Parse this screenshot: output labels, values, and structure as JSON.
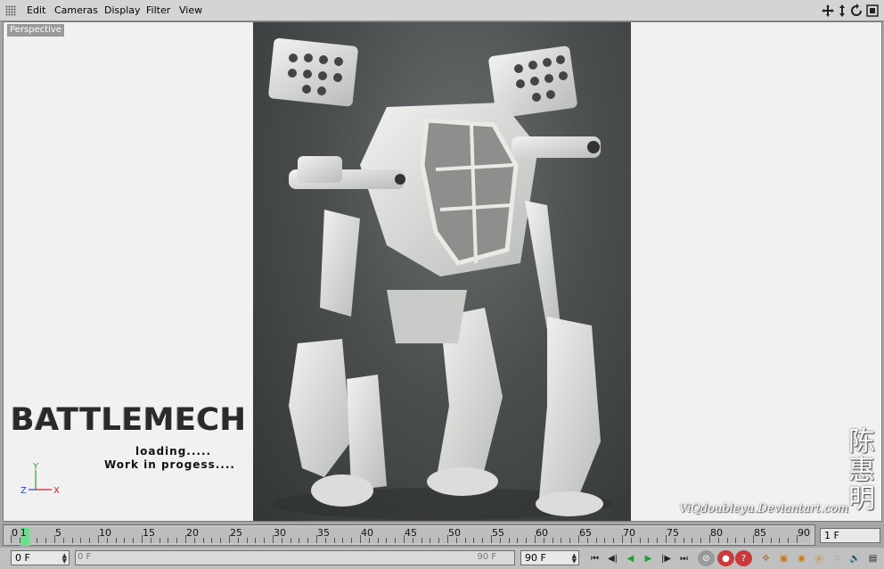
{
  "menu": {
    "items": [
      "Edit",
      "Cameras",
      "Display",
      "Filter",
      "View"
    ]
  },
  "nav_icons": [
    "move-icon",
    "zoom-icon",
    "rotate-icon",
    "maximize-icon"
  ],
  "viewport": {
    "camera_label": "Perspective",
    "overlay": {
      "title": "BATTLEMECH",
      "loading": "loading.....",
      "wip": "Work in progess....",
      "signature": "ViQdoubleyu.Deviantart.com",
      "chinese_chars": [
        "陈",
        "惠",
        "明"
      ]
    },
    "axis": {
      "y": "Y",
      "z": "Z",
      "x": "X"
    }
  },
  "timeline": {
    "labels": [
      "0",
      "1",
      "5",
      "10",
      "15",
      "20",
      "25",
      "30",
      "35",
      "40",
      "45",
      "50",
      "55",
      "60",
      "65",
      "70",
      "75",
      "80",
      "85",
      "90"
    ],
    "current_frame": 1,
    "frame_rate_field": "1 F"
  },
  "bottom": {
    "start_field": "0 F",
    "range_start": "0 F",
    "range_end": "90 F",
    "end_field": "90 F",
    "transport": [
      "go-to-start-icon",
      "prev-key-icon",
      "play-backward-icon",
      "play-forward-icon",
      "next-key-icon",
      "go-to-end-icon"
    ],
    "tools": [
      "record-icon",
      "autokey-icon",
      "keyframe-help-icon",
      "position-track-icon",
      "scale-track-icon",
      "rotation-track-icon",
      "parameter-track-icon",
      "point-level-icon",
      "sound-icon",
      "scheme-icon"
    ]
  },
  "colors": {
    "accent_green": "#6be08c",
    "panel": "#d4d4d4",
    "viewport_bg": "#f1f1f1"
  }
}
